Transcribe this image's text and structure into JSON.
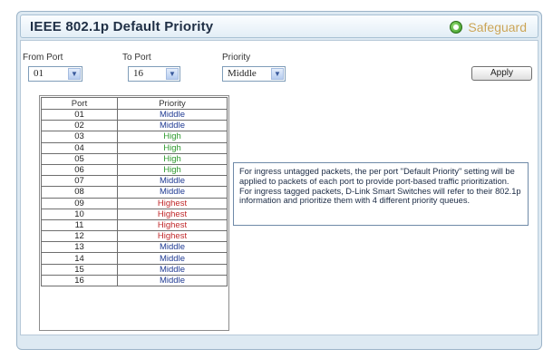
{
  "header": {
    "title": "IEEE 802.1p Default Priority",
    "safeguard_label": "Safeguard"
  },
  "form": {
    "from_port": {
      "label": "From Port",
      "value": "01"
    },
    "to_port": {
      "label": "To Port",
      "value": "16"
    },
    "priority": {
      "label": "Priority",
      "value": "Middle"
    },
    "apply_label": "Apply"
  },
  "table": {
    "headers": [
      "Port",
      "Priority"
    ],
    "rows": [
      {
        "port": "01",
        "priority": "Middle"
      },
      {
        "port": "02",
        "priority": "Middle"
      },
      {
        "port": "03",
        "priority": "High"
      },
      {
        "port": "04",
        "priority": "High"
      },
      {
        "port": "05",
        "priority": "High"
      },
      {
        "port": "06",
        "priority": "High"
      },
      {
        "port": "07",
        "priority": "Middle"
      },
      {
        "port": "08",
        "priority": "Middle"
      },
      {
        "port": "09",
        "priority": "Highest"
      },
      {
        "port": "10",
        "priority": "Highest"
      },
      {
        "port": "11",
        "priority": "Highest"
      },
      {
        "port": "12",
        "priority": "Highest"
      },
      {
        "port": "13",
        "priority": "Middle"
      },
      {
        "port": "14",
        "priority": "Middle"
      },
      {
        "port": "15",
        "priority": "Middle"
      },
      {
        "port": "16",
        "priority": "Middle"
      }
    ]
  },
  "info": {
    "line1": "For ingress untagged packets, the per port \"Default Priority\" setting will be applied to packets of each port to provide port-based traffic prioritization.",
    "line2": "For ingress tagged packets, D-Link Smart Switches will refer to their 802.1p information and prioritize them with 4 different priority queues."
  },
  "colors": {
    "middle": "#1f3a93",
    "high": "#2e9a2e",
    "highest": "#c0282a",
    "panel_bg": "#dde9f2"
  },
  "icons": {
    "safeguard": "status-circle-icon",
    "dropdown": "chevron-down-icon"
  }
}
